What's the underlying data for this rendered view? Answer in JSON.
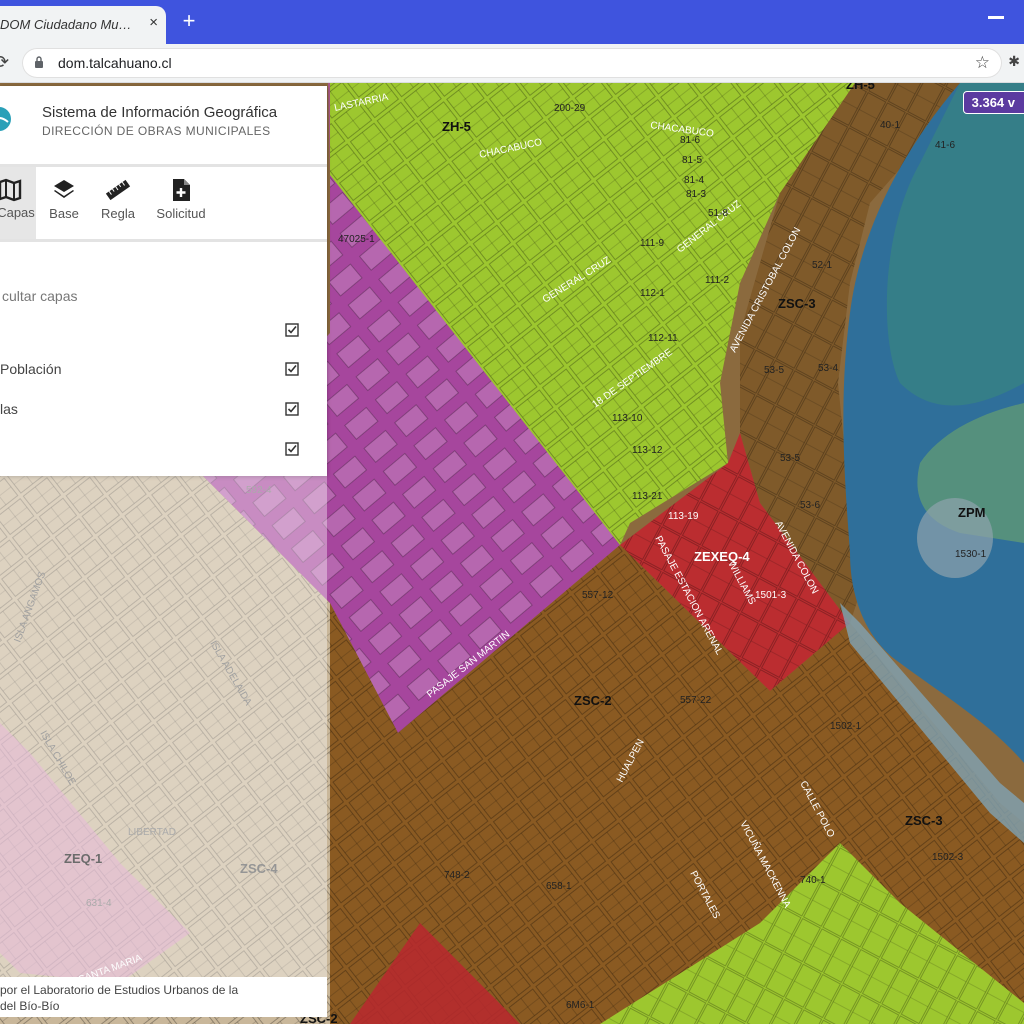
{
  "browser": {
    "tab_title": "DOM Ciudadano Municipal",
    "tab_close": "×",
    "new_tab": "+",
    "url": "dom.talcahuano.cl",
    "star_icon": "☆",
    "extension_icon": "puzzle-icon"
  },
  "header": {
    "title": "Sistema de Información Geográfica",
    "subtitle": "DIRECCIÓN DE OBRAS MUNICIPALES"
  },
  "tools": [
    {
      "label": "Capas",
      "icon": "map-icon",
      "active": true
    },
    {
      "label": "Base",
      "icon": "layers-icon",
      "active": false
    },
    {
      "label": "Regla",
      "icon": "ruler-icon",
      "active": false
    },
    {
      "label": "Solicitud",
      "icon": "add-document-icon",
      "active": false
    }
  ],
  "layers_panel": {
    "hide_label": "cultar capas",
    "layers": [
      {
        "label": "",
        "checked": true
      },
      {
        "label": "Población",
        "checked": true
      },
      {
        "label": "las",
        "checked": true
      },
      {
        "label": "",
        "checked": true
      }
    ]
  },
  "scale_badge": "3.364 v",
  "credits": {
    "line1": "por el Laboratorio de Estudios Urbanos de la",
    "line2": "del Bío-Bío"
  },
  "map_labels": {
    "zones": [
      "ZH-5",
      "ZSC-3",
      "ZSC-2",
      "ZEXEQ-4",
      "ZPM",
      "ZSC-3",
      "ZEQ-1",
      "ZSC-4",
      "ZSC-2",
      "ZH-5"
    ],
    "streets": [
      "LASTARRIA",
      "CHACABUCO",
      "CHACABUCO",
      "GENERAL CRUZ",
      "GENERAL CRUZ",
      "18 DE SEPTIEMBRE",
      "AVENIDA CRISTOBAL COLON",
      "PASAJE ESTACION ARENAL",
      "WILLIAMS",
      "PASAJE SAN MARTIN",
      "HUALPEN",
      "VICUÑA MACKENNA",
      "CALLE POLO",
      "PORTALES",
      "AVENIDA COLON",
      "SANTA MARIA",
      "LIBERTAD",
      "ISLA ANGAMOS",
      "ISLA ADELAIDA",
      "ISLA CHILOE"
    ],
    "lots": [
      "200-29",
      "40-1",
      "81-6",
      "81-5",
      "81-4",
      "81-3",
      "51-8",
      "111-9",
      "112-1",
      "112-11",
      "113-10",
      "113-12",
      "47025-1",
      "52-1",
      "53-5",
      "53-4",
      "53-6",
      "53-5",
      "113-19",
      "1501-3",
      "1530-1",
      "1502-1",
      "1502-3",
      "592-4",
      "557-12",
      "557-22",
      "748-2",
      "658-1",
      "631-4",
      "740-1",
      "41-6",
      "111-2",
      "113-21",
      "6M6-1"
    ]
  },
  "colors": {
    "tab_bar": "#3f54de",
    "zone_green": "#9fd12e",
    "zone_brown": "#8a5a22",
    "zone_magenta": "#b14ab4",
    "zone_red": "#c0272f",
    "water_blue": "#3c7fb0",
    "zone_pink": "#d98fc4"
  }
}
